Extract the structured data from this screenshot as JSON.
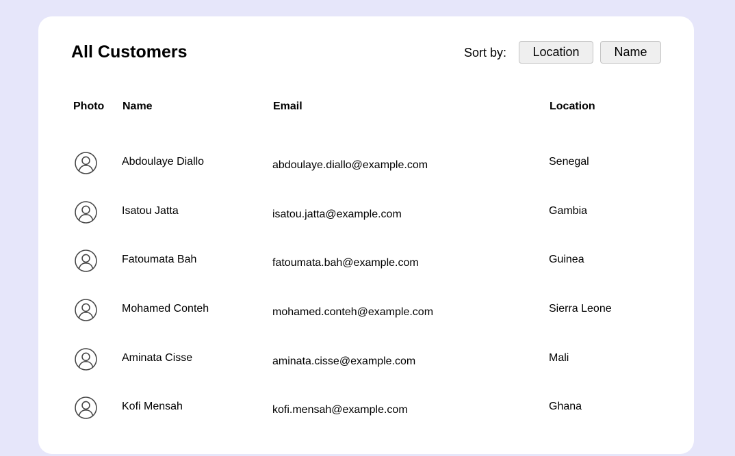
{
  "page": {
    "title": "All Customers",
    "background_color": "#e6e6fa",
    "card_color": "#ffffff"
  },
  "sort": {
    "label": "Sort by:",
    "buttons": [
      "Location",
      "Name"
    ]
  },
  "table": {
    "headers": {
      "photo": "Photo",
      "name": "Name",
      "email": "Email",
      "location": "Location"
    },
    "photo_icon": "user-circle-icon",
    "rows": [
      {
        "name": "Abdoulaye Diallo",
        "email": "abdoulaye.diallo@example.com",
        "location": "Senegal"
      },
      {
        "name": "Isatou Jatta",
        "email": "isatou.jatta@example.com",
        "location": "Gambia"
      },
      {
        "name": "Fatoumata Bah",
        "email": "fatoumata.bah@example.com",
        "location": "Guinea"
      },
      {
        "name": "Mohamed Conteh",
        "email": "mohamed.conteh@example.com",
        "location": "Sierra Leone"
      },
      {
        "name": "Aminata Cisse",
        "email": "aminata.cisse@example.com",
        "location": "Mali"
      },
      {
        "name": "Kofi Mensah",
        "email": "kofi.mensah@example.com",
        "location": "Ghana"
      }
    ]
  }
}
